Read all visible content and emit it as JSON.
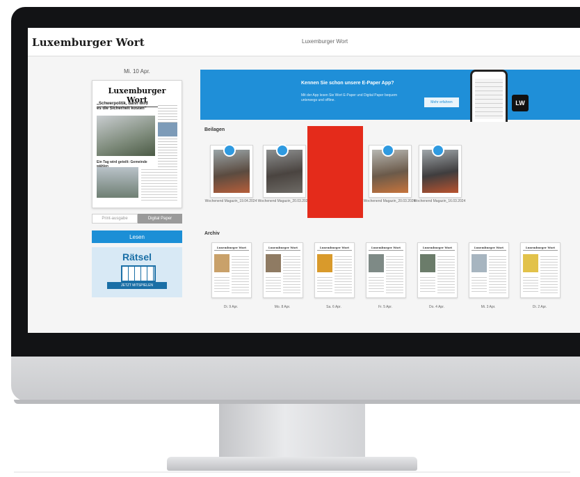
{
  "header": {
    "logo": "Luxemburger Wort",
    "center_title": "Luxemburger Wort"
  },
  "left": {
    "issue_date": "Mi. 10 Apr.",
    "front_page": {
      "masthead": "Luxemburger Wort",
      "headline": "„Schwerpolitik, dann wird es die Sicherheit kosten“",
      "subhead": "Ein Tag wird geteilt: Gemeinde wählen"
    },
    "toggle": {
      "option_a": "Print-ausgabe",
      "option_b": "Digital Paper"
    },
    "read_button": "Lesen",
    "puzzle": {
      "title": "Rätsel",
      "button": "JETZT MITSPIELEN"
    }
  },
  "banner": {
    "title": "Kennen Sie schon unsere E-Paper App?",
    "text": "Mit der App lesen Sie Wort E-Paper und Digital Paper bequem unterwegs und offline.",
    "button": "Mehr erfahren",
    "qr_label": "LW"
  },
  "supplements": {
    "heading": "Beilagen",
    "items": [
      {
        "caption": "Wochenend Magazin_19.04.2024"
      },
      {
        "caption": "Wochenend Magazin_20.03.2024"
      },
      {
        "caption": "Wochenend Magazin_20.03.2024"
      },
      {
        "caption": "Wochenend Magazin_16.03.2024"
      }
    ]
  },
  "archive": {
    "heading": "Archiv",
    "items": [
      {
        "masthead": "Luxemburger Wort",
        "date": "Di. 9 Apr.",
        "photo_color": "#c9a16a"
      },
      {
        "masthead": "Luxemburger Wort",
        "date": "Mo. 8 Apr.",
        "photo_color": "#8f7b63"
      },
      {
        "masthead": "Luxemburger Wort",
        "date": "Sa. 6 Apr.",
        "photo_color": "#d99a2b"
      },
      {
        "masthead": "Luxemburger Wort",
        "date": "Fr. 5 Apr.",
        "photo_color": "#7e8a86"
      },
      {
        "masthead": "Luxemburger Wort",
        "date": "Do. 4 Apr.",
        "photo_color": "#6b7c6a"
      },
      {
        "masthead": "Luxemburger Wort",
        "date": "Mi. 3 Apr.",
        "photo_color": "#a7b5c0"
      },
      {
        "masthead": "Luxemburger Wort",
        "date": "Di. 2 Apr.",
        "photo_color": "#e2c24a"
      }
    ]
  },
  "colors": {
    "accent_blue": "#1f8fd8",
    "redaction": "#e42b1b",
    "bezel": "#121315"
  }
}
